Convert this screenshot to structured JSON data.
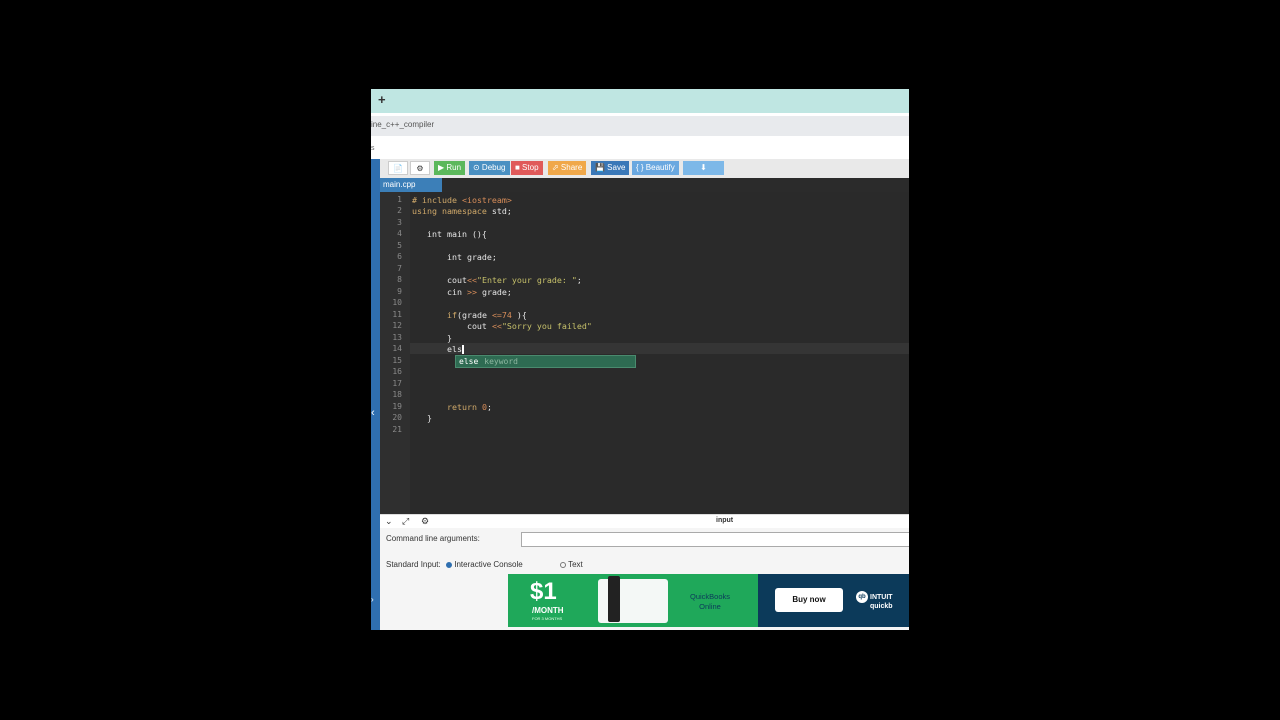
{
  "browser": {
    "new_tab": "+",
    "url": "ine_c++_compiler",
    "sub": "s"
  },
  "toolbar": {
    "new_icon": "📄",
    "settings_icon": "⚙",
    "run": "▶ Run",
    "debug": "⊙ Debug",
    "stop": "■ Stop",
    "share": "⬀ Share",
    "save": "💾 Save",
    "beautify": "{ } Beautify",
    "download": "⬇",
    "colors": {
      "run": "#5cb85c",
      "debug": "#4a90c2",
      "stop": "#e05a5a",
      "share": "#f0a84a",
      "save": "#3a78b8",
      "beautify": "#6aa8e0",
      "download": "#7db8e8"
    }
  },
  "file_tab": "main.cpp",
  "editor": {
    "line_numbers": [
      "1",
      "2",
      "3",
      "4",
      "5",
      "6",
      "7",
      "8",
      "9",
      "10",
      "11",
      "12",
      "13",
      "14",
      "15",
      "16",
      "17",
      "18",
      "19",
      "20",
      "21"
    ],
    "autocomplete": {
      "word": "else",
      "meta": "keyword"
    }
  },
  "io": {
    "title": "input",
    "args_label": "Command line arguments:",
    "stdin_label": "Standard Input:",
    "interactive": "Interactive Console",
    "text": "Text"
  },
  "ad": {
    "price": "$1",
    "per": "/MONTH",
    "fine": "FOR 3 MONTHS",
    "product_line1": "QuickBooks",
    "product_line2": "Online",
    "buy": "Buy now",
    "brand_line1": "INTUIT",
    "brand_line2": "quickb",
    "brand_badge": "qb"
  }
}
